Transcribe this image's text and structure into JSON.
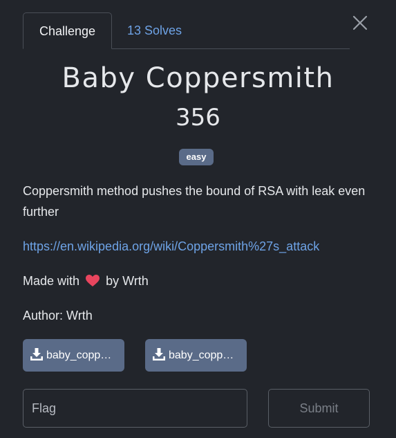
{
  "tabs": [
    {
      "label": "Challenge",
      "active": true
    },
    {
      "label": "13 Solves",
      "active": false
    }
  ],
  "challenge": {
    "name": "Baby Coppersmith",
    "points": "356",
    "difficulty": "easy",
    "description": "Coppersmith method pushes the bound of RSA with leak even further",
    "link": "https://en.wikipedia.org/wiki/Coppersmith%27s_attack",
    "made_with_prefix": "Made with",
    "made_with_suffix": "by Wrth",
    "author_line": "Author: Wrth"
  },
  "files": [
    {
      "label": "baby_copp…",
      "icon": "download-icon"
    },
    {
      "label": "baby_copp…",
      "icon": "download-icon"
    }
  ],
  "form": {
    "flag_placeholder": "Flag",
    "submit_label": "Submit"
  },
  "icons": {
    "close": "close-icon",
    "heart": "heart-icon",
    "download": "download-icon"
  },
  "colors": {
    "background": "#22252b",
    "link": "#6ea3e6",
    "badge": "#5a6b88",
    "heart": "#e8455e"
  }
}
